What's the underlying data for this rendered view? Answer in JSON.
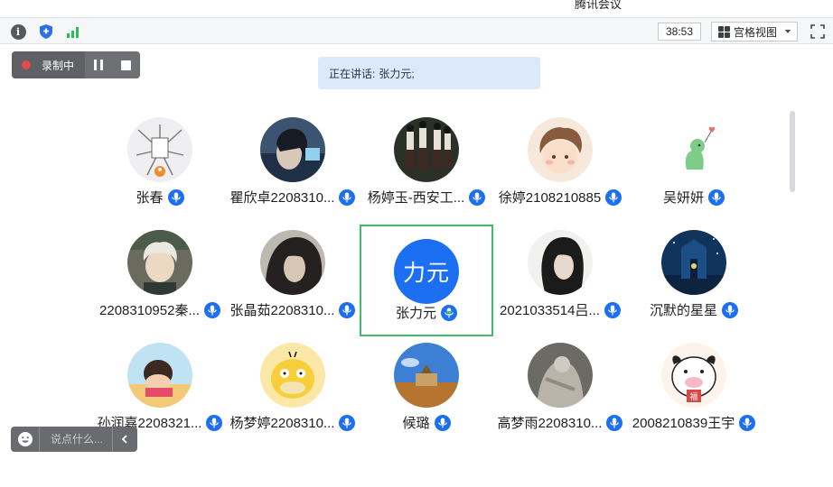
{
  "window": {
    "title": "腾讯会议"
  },
  "toolbar": {
    "timer": "38:53",
    "view_label": "宫格视图",
    "icons": {
      "info": "info-icon",
      "shield": "shield-icon",
      "signal": "signal-icon",
      "view": "grid-icon",
      "fullscreen": "fullscreen-icon"
    }
  },
  "recording": {
    "label": "录制中",
    "icons": [
      "record-dot-icon",
      "pause-icon",
      "stop-icon"
    ]
  },
  "speaking": {
    "prefix": "正在讲话:",
    "name": "张力元;"
  },
  "participants": [
    {
      "name": "张春",
      "avatar": "illustration",
      "mic": "mic-icon"
    },
    {
      "name": "瞿欣卓2208310...",
      "avatar": "photo",
      "mic": "mic-icon"
    },
    {
      "name": "杨婷玉-西安工...",
      "avatar": "photo",
      "mic": "mic-icon"
    },
    {
      "name": "徐婷2108210885",
      "avatar": "cartoon",
      "mic": "mic-icon"
    },
    {
      "name": "吴妍妍",
      "avatar": "dinosaur",
      "mic": "mic-icon"
    },
    {
      "name": "2208310952秦...",
      "avatar": "anime",
      "mic": "mic-icon"
    },
    {
      "name": "张晶茹2208310...",
      "avatar": "photo",
      "mic": "mic-icon"
    },
    {
      "name": "张力元",
      "avatar_text": "力元",
      "mic": "mic-active-icon",
      "active": true
    },
    {
      "name": "2021033514吕...",
      "avatar": "photo",
      "mic": "mic-icon"
    },
    {
      "name": "沉默的星星",
      "avatar": "night-scene",
      "mic": "mic-icon"
    },
    {
      "name": "孙润嘉2208321...",
      "avatar": "cartoon",
      "mic": "mic-icon"
    },
    {
      "name": "杨梦婷2208310...",
      "avatar": "psyduck",
      "mic": "mic-icon"
    },
    {
      "name": "候璐",
      "avatar": "landscape",
      "mic": "mic-icon"
    },
    {
      "name": "高梦雨2208310...",
      "avatar": "statue",
      "mic": "mic-icon"
    },
    {
      "name": "2008210839王宇",
      "avatar": "cow-cartoon",
      "avatar_text": "福",
      "mic": "mic-icon"
    }
  ],
  "chat": {
    "placeholder": "说点什么...",
    "icons": [
      "emoji-icon",
      "collapse-arrow-icon"
    ]
  },
  "colors": {
    "accent": "#1d6ff2",
    "active_border": "#3dbd6b",
    "banner": "#dce9fb",
    "recording": "#e34a4a"
  }
}
